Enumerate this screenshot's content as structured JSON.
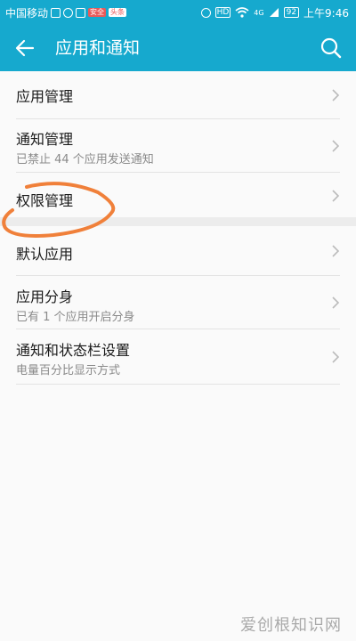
{
  "status_bar": {
    "carrier": "中国移动",
    "badge_a": "安全",
    "badge_b": "头条",
    "hd": "HD",
    "network": "4G",
    "battery": "92",
    "time": "上午9:46"
  },
  "appbar": {
    "title": "应用和通知",
    "back_icon": "arrow-left",
    "search_icon": "magnifier"
  },
  "list": {
    "group1": [
      {
        "title": "应用管理",
        "subtitle": ""
      },
      {
        "title": "通知管理",
        "subtitle": "已禁止 44 个应用发送通知"
      },
      {
        "title": "权限管理",
        "subtitle": ""
      }
    ],
    "group2": [
      {
        "title": "默认应用",
        "subtitle": ""
      },
      {
        "title": "应用分身",
        "subtitle": "已有 1 个应用开启分身"
      },
      {
        "title": "通知和状态栏设置",
        "subtitle": "电量百分比显示方式"
      }
    ]
  },
  "watermark": "爱创根知识网",
  "colors": {
    "accent": "#16a9ce",
    "annotation": "#f0803a"
  }
}
